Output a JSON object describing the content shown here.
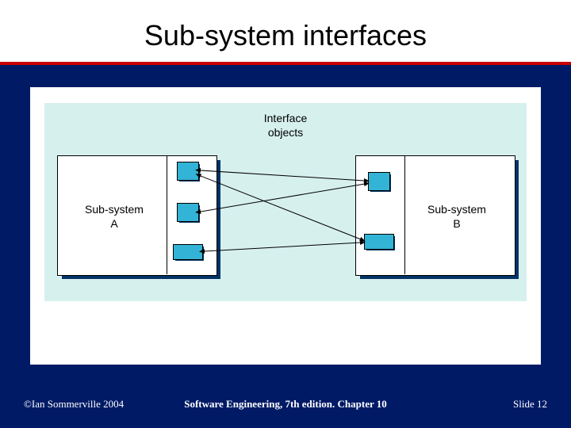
{
  "title": "Sub-system interfaces",
  "diagram": {
    "interface_label_line1": "Interface",
    "interface_label_line2": "objects",
    "subsystem_a_line1": "Sub-system",
    "subsystem_a_line2": "A",
    "subsystem_b_line1": "Sub-system",
    "subsystem_b_line2": "B",
    "connections": [
      {
        "from": "A-right-top",
        "to": "B-left-top"
      },
      {
        "from": "A-right-top",
        "to": "B-left-bottom"
      },
      {
        "from": "A-right-mid",
        "to": "B-left-top"
      },
      {
        "from": "A-right-bot",
        "to": "B-left-bottom"
      }
    ]
  },
  "footer": {
    "left": "©Ian Sommerville 2004",
    "center": "Software Engineering, 7th edition. Chapter 10",
    "right_prefix": "Slide ",
    "right_num": "12"
  }
}
